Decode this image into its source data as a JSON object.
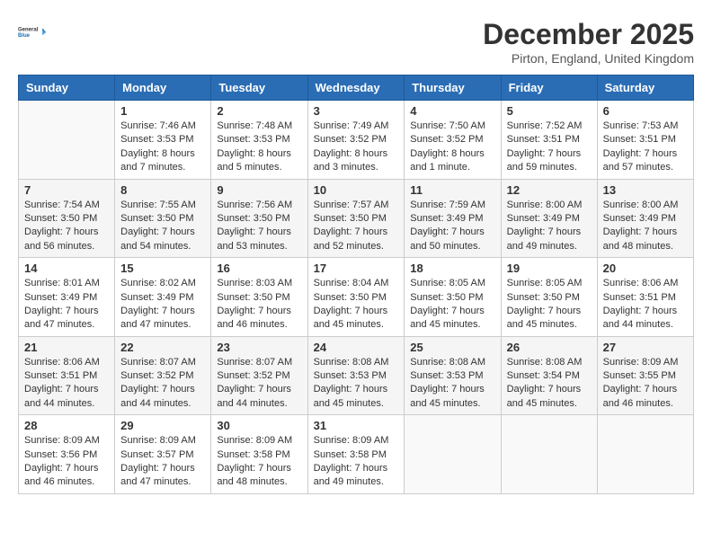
{
  "header": {
    "logo": {
      "line1": "General",
      "line2": "Blue"
    },
    "title": "December 2025",
    "location": "Pirton, England, United Kingdom"
  },
  "days_of_week": [
    "Sunday",
    "Monday",
    "Tuesday",
    "Wednesday",
    "Thursday",
    "Friday",
    "Saturday"
  ],
  "weeks": [
    [
      {
        "num": "",
        "info": ""
      },
      {
        "num": "1",
        "info": "Sunrise: 7:46 AM\nSunset: 3:53 PM\nDaylight: 8 hours\nand 7 minutes."
      },
      {
        "num": "2",
        "info": "Sunrise: 7:48 AM\nSunset: 3:53 PM\nDaylight: 8 hours\nand 5 minutes."
      },
      {
        "num": "3",
        "info": "Sunrise: 7:49 AM\nSunset: 3:52 PM\nDaylight: 8 hours\nand 3 minutes."
      },
      {
        "num": "4",
        "info": "Sunrise: 7:50 AM\nSunset: 3:52 PM\nDaylight: 8 hours\nand 1 minute."
      },
      {
        "num": "5",
        "info": "Sunrise: 7:52 AM\nSunset: 3:51 PM\nDaylight: 7 hours\nand 59 minutes."
      },
      {
        "num": "6",
        "info": "Sunrise: 7:53 AM\nSunset: 3:51 PM\nDaylight: 7 hours\nand 57 minutes."
      }
    ],
    [
      {
        "num": "7",
        "info": "Sunrise: 7:54 AM\nSunset: 3:50 PM\nDaylight: 7 hours\nand 56 minutes."
      },
      {
        "num": "8",
        "info": "Sunrise: 7:55 AM\nSunset: 3:50 PM\nDaylight: 7 hours\nand 54 minutes."
      },
      {
        "num": "9",
        "info": "Sunrise: 7:56 AM\nSunset: 3:50 PM\nDaylight: 7 hours\nand 53 minutes."
      },
      {
        "num": "10",
        "info": "Sunrise: 7:57 AM\nSunset: 3:50 PM\nDaylight: 7 hours\nand 52 minutes."
      },
      {
        "num": "11",
        "info": "Sunrise: 7:59 AM\nSunset: 3:49 PM\nDaylight: 7 hours\nand 50 minutes."
      },
      {
        "num": "12",
        "info": "Sunrise: 8:00 AM\nSunset: 3:49 PM\nDaylight: 7 hours\nand 49 minutes."
      },
      {
        "num": "13",
        "info": "Sunrise: 8:00 AM\nSunset: 3:49 PM\nDaylight: 7 hours\nand 48 minutes."
      }
    ],
    [
      {
        "num": "14",
        "info": "Sunrise: 8:01 AM\nSunset: 3:49 PM\nDaylight: 7 hours\nand 47 minutes."
      },
      {
        "num": "15",
        "info": "Sunrise: 8:02 AM\nSunset: 3:49 PM\nDaylight: 7 hours\nand 47 minutes."
      },
      {
        "num": "16",
        "info": "Sunrise: 8:03 AM\nSunset: 3:50 PM\nDaylight: 7 hours\nand 46 minutes."
      },
      {
        "num": "17",
        "info": "Sunrise: 8:04 AM\nSunset: 3:50 PM\nDaylight: 7 hours\nand 45 minutes."
      },
      {
        "num": "18",
        "info": "Sunrise: 8:05 AM\nSunset: 3:50 PM\nDaylight: 7 hours\nand 45 minutes."
      },
      {
        "num": "19",
        "info": "Sunrise: 8:05 AM\nSunset: 3:50 PM\nDaylight: 7 hours\nand 45 minutes."
      },
      {
        "num": "20",
        "info": "Sunrise: 8:06 AM\nSunset: 3:51 PM\nDaylight: 7 hours\nand 44 minutes."
      }
    ],
    [
      {
        "num": "21",
        "info": "Sunrise: 8:06 AM\nSunset: 3:51 PM\nDaylight: 7 hours\nand 44 minutes."
      },
      {
        "num": "22",
        "info": "Sunrise: 8:07 AM\nSunset: 3:52 PM\nDaylight: 7 hours\nand 44 minutes."
      },
      {
        "num": "23",
        "info": "Sunrise: 8:07 AM\nSunset: 3:52 PM\nDaylight: 7 hours\nand 44 minutes."
      },
      {
        "num": "24",
        "info": "Sunrise: 8:08 AM\nSunset: 3:53 PM\nDaylight: 7 hours\nand 45 minutes."
      },
      {
        "num": "25",
        "info": "Sunrise: 8:08 AM\nSunset: 3:53 PM\nDaylight: 7 hours\nand 45 minutes."
      },
      {
        "num": "26",
        "info": "Sunrise: 8:08 AM\nSunset: 3:54 PM\nDaylight: 7 hours\nand 45 minutes."
      },
      {
        "num": "27",
        "info": "Sunrise: 8:09 AM\nSunset: 3:55 PM\nDaylight: 7 hours\nand 46 minutes."
      }
    ],
    [
      {
        "num": "28",
        "info": "Sunrise: 8:09 AM\nSunset: 3:56 PM\nDaylight: 7 hours\nand 46 minutes."
      },
      {
        "num": "29",
        "info": "Sunrise: 8:09 AM\nSunset: 3:57 PM\nDaylight: 7 hours\nand 47 minutes."
      },
      {
        "num": "30",
        "info": "Sunrise: 8:09 AM\nSunset: 3:58 PM\nDaylight: 7 hours\nand 48 minutes."
      },
      {
        "num": "31",
        "info": "Sunrise: 8:09 AM\nSunset: 3:58 PM\nDaylight: 7 hours\nand 49 minutes."
      },
      {
        "num": "",
        "info": ""
      },
      {
        "num": "",
        "info": ""
      },
      {
        "num": "",
        "info": ""
      }
    ]
  ]
}
